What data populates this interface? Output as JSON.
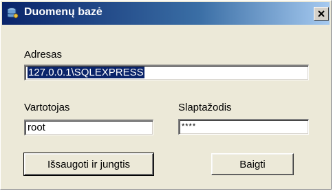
{
  "window": {
    "title": "Duomenų bazė",
    "icon": "database-icon",
    "close_icon": "close-icon",
    "colors": {
      "titlebar_start": "#0a246a",
      "titlebar_end": "#a6caf0",
      "face": "#ece9d8",
      "selection": "#0a246a"
    }
  },
  "form": {
    "address_label": "Adresas",
    "address_value": "127.0.0.1\\SQLEXPRESS",
    "user_label": "Vartotojas",
    "user_value": "root",
    "password_label": "Slaptažodis",
    "password_value": "****"
  },
  "buttons": {
    "save_connect": "Išsaugoti ir jungtis",
    "finish": "Baigti"
  }
}
